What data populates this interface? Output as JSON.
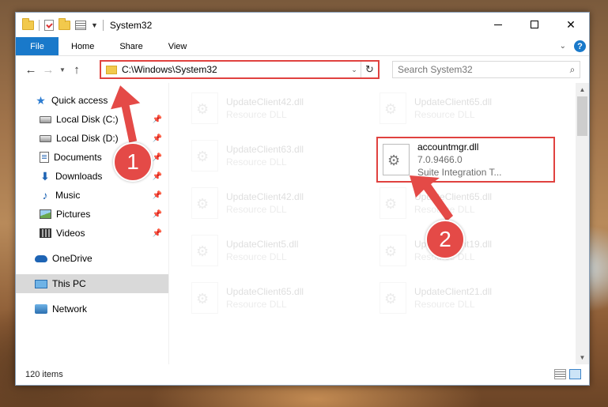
{
  "window": {
    "title": "System32"
  },
  "ribbon": {
    "tabs": [
      "File",
      "Home",
      "Share",
      "View"
    ],
    "help": "?"
  },
  "address": {
    "path": "C:\\Windows\\System32"
  },
  "search": {
    "placeholder": "Search System32"
  },
  "sidebar": {
    "items": [
      {
        "label": "Quick access",
        "icon": "star-icon"
      },
      {
        "label": "Local Disk (C:)",
        "icon": "drive-icon",
        "pinned": true
      },
      {
        "label": "Local Disk (D:)",
        "icon": "drive-icon",
        "pinned": true
      },
      {
        "label": "Documents",
        "icon": "documents-icon",
        "pinned": true
      },
      {
        "label": "Downloads",
        "icon": "downloads-icon",
        "pinned": true
      },
      {
        "label": "Music",
        "icon": "music-icon",
        "pinned": true
      },
      {
        "label": "Pictures",
        "icon": "pictures-icon",
        "pinned": true
      },
      {
        "label": "Videos",
        "icon": "videos-icon",
        "pinned": true
      },
      {
        "label": "OneDrive",
        "icon": "onedrive-icon"
      },
      {
        "label": "This PC",
        "icon": "this-pc-icon",
        "selected": true
      },
      {
        "label": "Network",
        "icon": "network-icon"
      }
    ]
  },
  "files": [
    {
      "name": "UpdateClient42.dll",
      "type": "Resource DLL"
    },
    {
      "name": "UpdateClient65.dll",
      "type": "Resource DLL"
    },
    {
      "name": "UpdateClient63.dll",
      "type": "Resource DLL"
    },
    {
      "name": "accountmgr.dll",
      "version": "7.0.9466.0",
      "description": "Suite Integration T..."
    },
    {
      "name": "UpdateClient42.dll",
      "type": "Resource DLL"
    },
    {
      "name": "UpdateClient65.dll",
      "type": "Resource DLL"
    },
    {
      "name": "UpdateClient5.dll",
      "type": "Resource DLL"
    },
    {
      "name": "UpdateClient19.dll",
      "type": "Resource DLL"
    },
    {
      "name": "UpdateClient65.dll",
      "type": "Resource DLL"
    },
    {
      "name": "UpdateClient21.dll",
      "type": "Resource DLL"
    }
  ],
  "status": {
    "count": "120 items"
  },
  "callouts": [
    "1",
    "2"
  ],
  "colors": {
    "accent": "#1979ca",
    "highlight": "#e0423f"
  }
}
